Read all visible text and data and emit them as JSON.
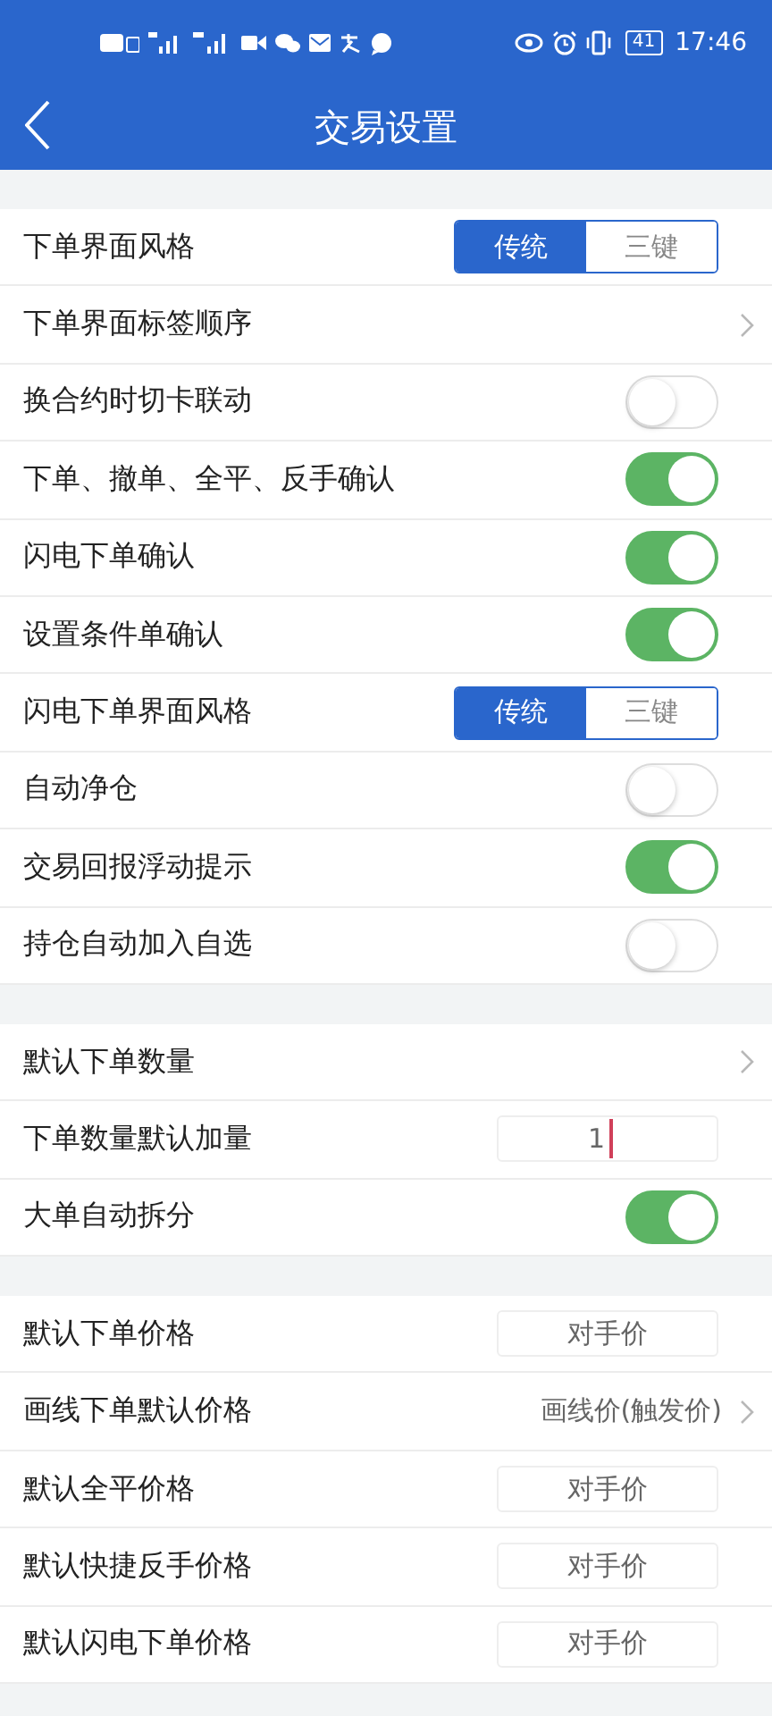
{
  "status_bar": {
    "battery": "41",
    "time": "17:46"
  },
  "header": {
    "title": "交易设置"
  },
  "sections": [
    {
      "rows": [
        {
          "kind": "segment",
          "label": "下单界面风格",
          "options": [
            {
              "label": "传统",
              "selected": true
            },
            {
              "label": "三键",
              "selected": false
            }
          ]
        },
        {
          "kind": "link",
          "label": "下单界面标签顺序"
        },
        {
          "kind": "toggle",
          "label": "换合约时切卡联动",
          "on": false
        },
        {
          "kind": "toggle",
          "label": "下单、撤单、全平、反手确认",
          "on": true
        },
        {
          "kind": "toggle",
          "label": "闪电下单确认",
          "on": true
        },
        {
          "kind": "toggle",
          "label": "设置条件单确认",
          "on": true
        },
        {
          "kind": "segment",
          "label": "闪电下单界面风格",
          "options": [
            {
              "label": "传统",
              "selected": true
            },
            {
              "label": "三键",
              "selected": false
            }
          ]
        },
        {
          "kind": "toggle",
          "label": "自动净仓",
          "on": false
        },
        {
          "kind": "toggle",
          "label": "交易回报浮动提示",
          "on": true
        },
        {
          "kind": "toggle",
          "label": "持仓自动加入自选",
          "on": false
        }
      ]
    },
    {
      "rows": [
        {
          "kind": "link",
          "label": "默认下单数量"
        },
        {
          "kind": "field",
          "label": "下单数量默认加量",
          "value": "1",
          "focused": true
        },
        {
          "kind": "toggle",
          "label": "大单自动拆分",
          "on": true
        }
      ]
    },
    {
      "rows": [
        {
          "kind": "select",
          "label": "默认下单价格",
          "value": "对手价"
        },
        {
          "kind": "link",
          "label": "画线下单默认价格",
          "value": "画线价(触发价)"
        },
        {
          "kind": "select",
          "label": "默认全平价格",
          "value": "对手价"
        },
        {
          "kind": "select",
          "label": "默认快捷反手价格",
          "value": "对手价"
        },
        {
          "kind": "select",
          "label": "默认闪电下单价格",
          "value": "对手价"
        }
      ]
    }
  ]
}
